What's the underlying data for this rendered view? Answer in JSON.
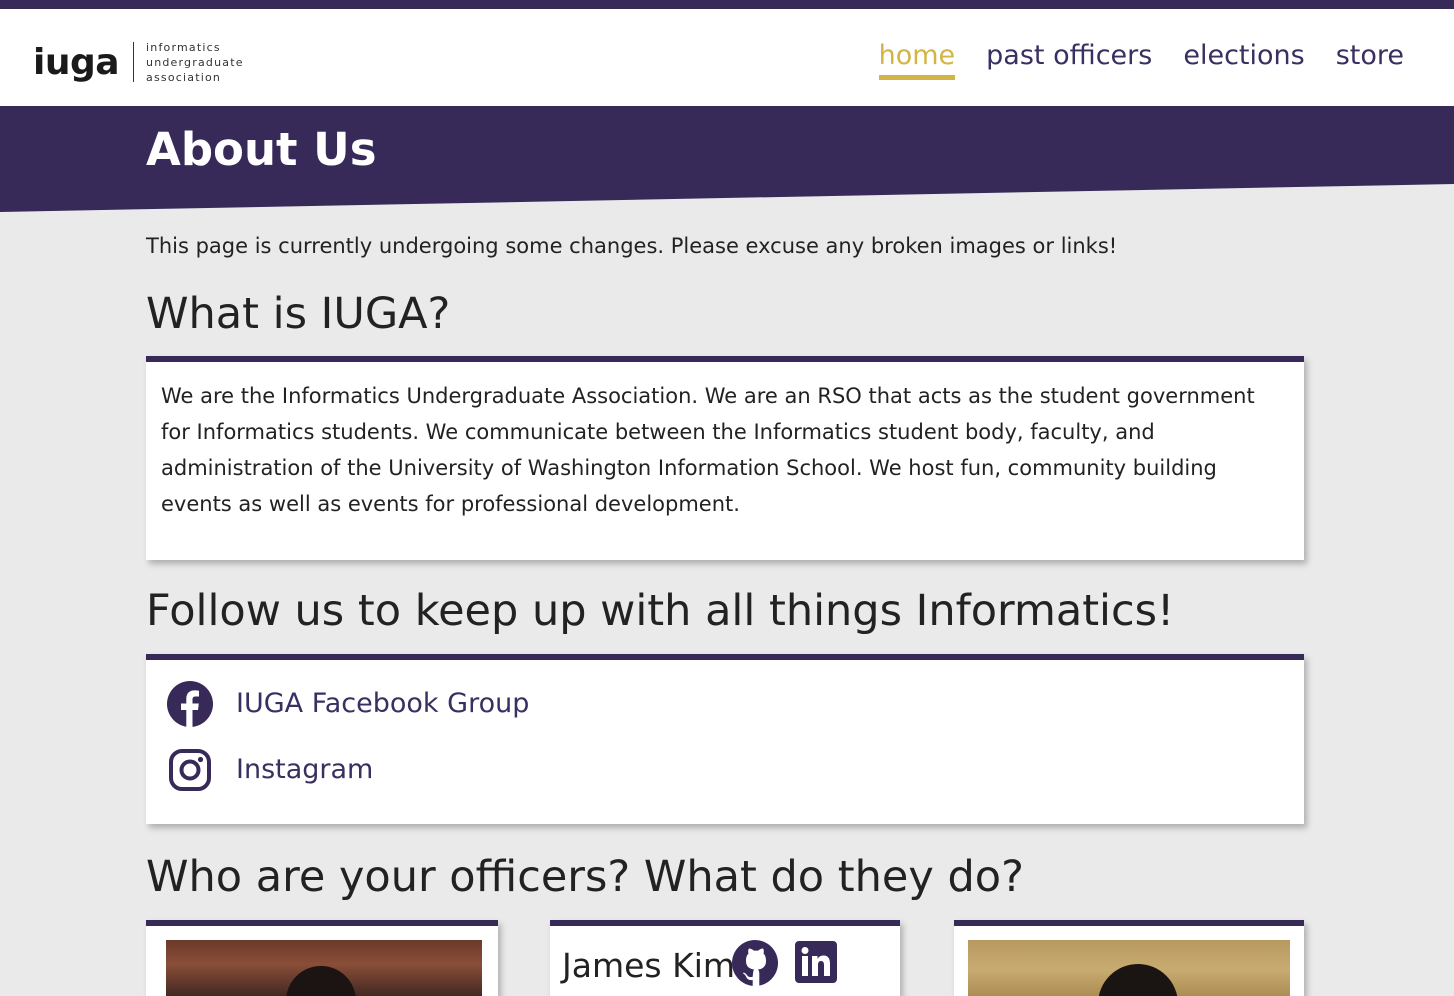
{
  "colors": {
    "primary": "#372a58",
    "accent": "#d2b546",
    "background": "#eaeaea",
    "card": "#ffffff"
  },
  "logo": {
    "mark": "iuga",
    "lines": [
      "informatics",
      "undergraduate",
      "association"
    ]
  },
  "nav": {
    "home": "home",
    "past_officers": "past officers",
    "elections": "elections",
    "store": "store",
    "active": "home"
  },
  "hero": {
    "title": "About Us"
  },
  "notice": "This page is currently undergoing some changes. Please excuse any broken images or links!",
  "what": {
    "heading": "What is IUGA?",
    "body": "We are the Informatics Undergraduate Association. We are an RSO that acts as the student government for Informatics students. We communicate between the Informatics student body, faculty, and administration of the University of Washington Information School. We host fun, community building events as well as events for professional development."
  },
  "follow": {
    "heading": "Follow us to keep up with all things Informatics!",
    "links": [
      {
        "label": "IUGA Facebook Group",
        "icon": "facebook-icon"
      },
      {
        "label": "Instagram",
        "icon": "instagram-icon"
      }
    ]
  },
  "officers": {
    "heading": "Who are your officers? What do they do?",
    "cards": [
      {
        "name": "",
        "photo": "officer-photo"
      },
      {
        "name": "James Kim",
        "icons": [
          "github-icon",
          "linkedin-icon"
        ]
      },
      {
        "name": "",
        "photo": "officer-photo"
      }
    ]
  }
}
